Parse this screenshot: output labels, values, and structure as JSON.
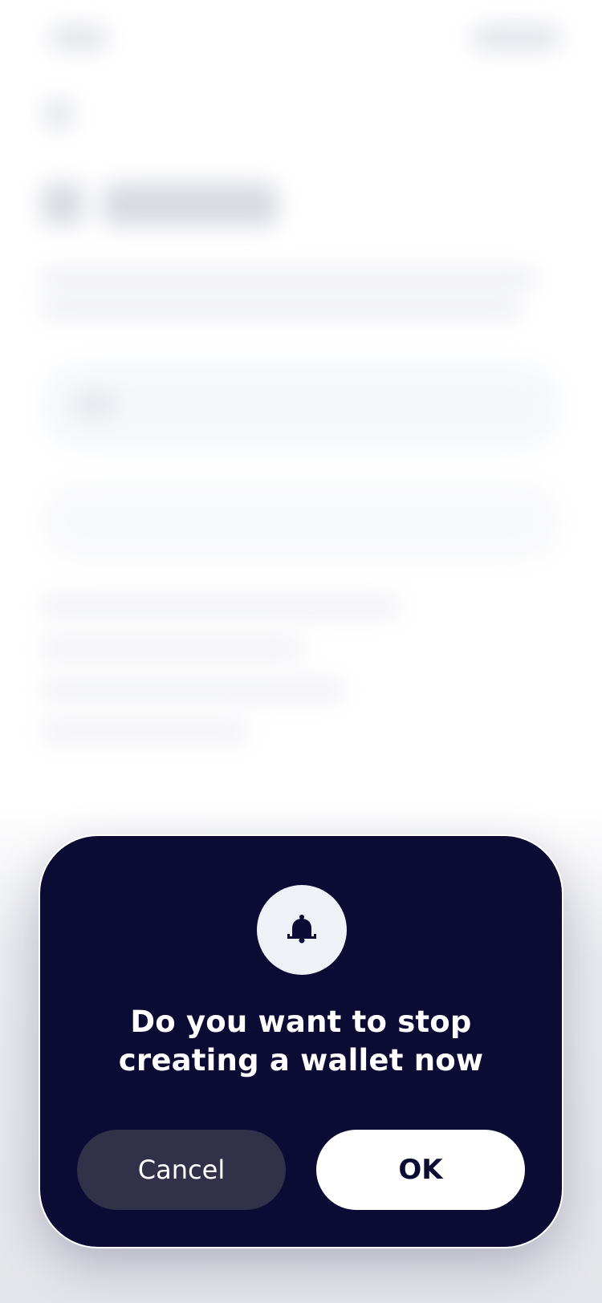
{
  "dialog": {
    "icon": "bell-icon",
    "title": "Do you want to stop creating a wallet now",
    "cancel_label": "Cancel",
    "ok_label": "OK"
  },
  "colors": {
    "dialog_background": "#0b0b33",
    "cancel_button": "#31314a",
    "ok_button": "#ffffff",
    "icon_circle": "#eef1f6"
  }
}
